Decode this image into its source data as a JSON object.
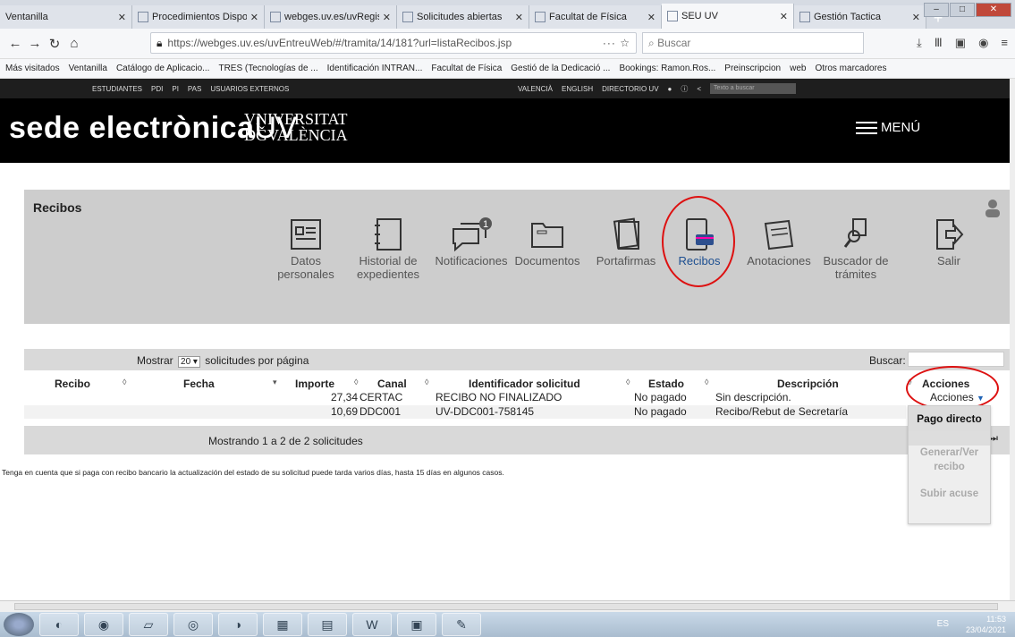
{
  "browser": {
    "tabs": [
      {
        "label": "Ventanilla",
        "active": false
      },
      {
        "label": "Procedimientos Dispo",
        "active": false
      },
      {
        "label": "webges.uv.es/uvRegist",
        "active": false
      },
      {
        "label": "Solicitudes abiertas",
        "active": false
      },
      {
        "label": "Facultat de Física",
        "active": false
      },
      {
        "label": "SEU UV",
        "active": true
      },
      {
        "label": "Gestión Tactica",
        "active": false
      }
    ],
    "url": "https://webges.uv.es/uvEntreuWeb/#/tramita/14/181?url=listaRecibos.jsp",
    "search_placeholder": "Buscar",
    "bookmarks": [
      "Más visitados",
      "Ventanilla",
      "Catálogo de Aplicacio...",
      "TRES (Tecnologías de ...",
      "Identificación INTRAN...",
      "Facultat de Física",
      "Gestió de la Dedicació ...",
      "Bookings: Ramon.Ros...",
      "Preinscripcion",
      "web",
      "Otros marcadores"
    ]
  },
  "uv_top": {
    "left_links": [
      "ESTUDIANTES",
      "PDI",
      "PI",
      "PAS",
      "USUARIOS EXTERNOS"
    ],
    "right_links": [
      "VALENCIÀ",
      "ENGLISH",
      "DIRECTORIO UV"
    ],
    "search_placeholder": "Texto a buscar"
  },
  "header": {
    "brand": "sede electrònica",
    "brand_suffix": "UV",
    "university_line1": "VNIVERSITAT",
    "university_line2": "DǦVALÈNCIA",
    "menu_label": "MENÚ"
  },
  "panel": {
    "title": "Recibos",
    "icons": [
      {
        "label": "Datos personales",
        "selected": false
      },
      {
        "label": "Historial de expedientes",
        "selected": false
      },
      {
        "label": "Notificaciones",
        "selected": false,
        "badge": "1"
      },
      {
        "label": "Documentos",
        "selected": false
      },
      {
        "label": "Portafirmas",
        "selected": false
      },
      {
        "label": "Recibos",
        "selected": true
      },
      {
        "label": "Anotaciones",
        "selected": false
      },
      {
        "label": "Buscador de trámites",
        "selected": false
      },
      {
        "label": "Salir",
        "selected": false
      }
    ]
  },
  "table": {
    "show_prefix": "Mostrar",
    "show_value": "20",
    "show_suffix": "solicitudes por página",
    "search_label": "Buscar:",
    "columns": [
      "Recibo",
      "Fecha",
      "Importe",
      "Canal",
      "Identificador solicitud",
      "Estado",
      "Descripción",
      "Acciones"
    ],
    "rows": [
      {
        "recibo": "",
        "fecha": "",
        "importe": "27,34",
        "canal": "CERTAC",
        "identificador": "RECIBO NO FINALIZADO",
        "estado": "No pagado",
        "descripcion": "Sin descripción.",
        "acciones": "Acciones"
      },
      {
        "recibo": "",
        "fecha": "",
        "importe": "10,69",
        "canal": "DDC001",
        "identificador": "UV-DDC001-758145",
        "estado": "No pagado",
        "descripcion": "Recibo/Rebut de Secretaría",
        "acciones": ""
      }
    ],
    "footer": "Mostrando 1 a 2 de 2 solicitudes",
    "note": "Tenga en cuenta que si paga con recibo bancario la actualización del estado de su solicitud puede tarda varios días, hasta 15 días en algunos casos."
  },
  "dropdown": {
    "items": [
      "Pago directo",
      "Generar/Ver recibo",
      "Subir acuse"
    ]
  },
  "taskbar": {
    "lang": "ES",
    "time": "11:53",
    "date": "23/04/2021"
  },
  "colors": {
    "accent": "#1d4f91",
    "highlight_circle": "#dd1111",
    "header_bg": "#000000",
    "panel_bg": "#cdcdcd"
  }
}
